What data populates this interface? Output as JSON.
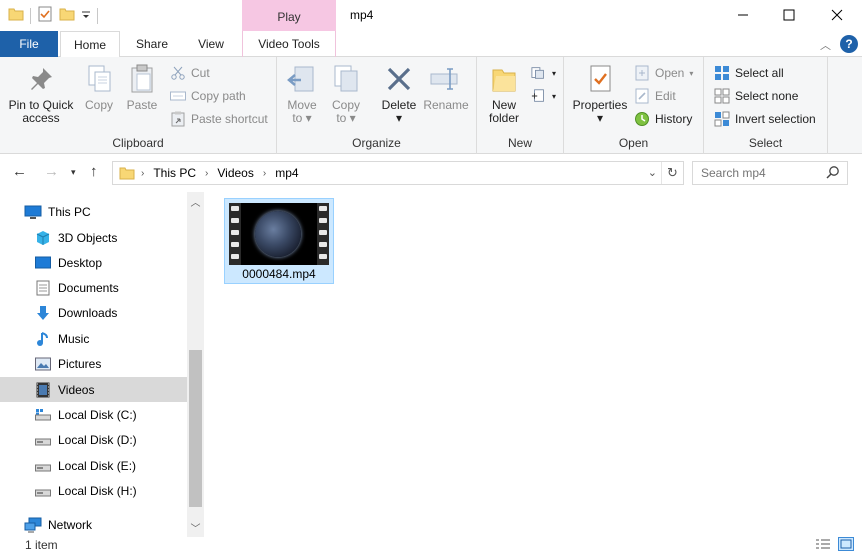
{
  "window": {
    "title": "mp4",
    "contextual_tab_header": "Play",
    "controls": {
      "minimize": "—",
      "maximize": "☐",
      "close": "✕"
    }
  },
  "tabs": {
    "file": "File",
    "home": "Home",
    "share": "Share",
    "view": "View",
    "video_tools": "Video Tools"
  },
  "ribbon": {
    "clipboard": {
      "label": "Clipboard",
      "pin_line1": "Pin to Quick",
      "pin_line2": "access",
      "copy": "Copy",
      "paste": "Paste",
      "cut": "Cut",
      "copy_path": "Copy path",
      "paste_shortcut": "Paste shortcut"
    },
    "organize": {
      "label": "Organize",
      "move_to": "Move",
      "move_to2": "to",
      "copy_to": "Copy",
      "copy_to2": "to",
      "delete": "Delete",
      "rename": "Rename"
    },
    "new": {
      "label": "New",
      "new_folder1": "New",
      "new_folder2": "folder"
    },
    "open": {
      "label": "Open",
      "properties": "Properties",
      "open": "Open",
      "edit": "Edit",
      "history": "History"
    },
    "select": {
      "label": "Select",
      "select_all": "Select all",
      "select_none": "Select none",
      "invert_selection": "Invert selection"
    }
  },
  "address": {
    "crumbs": [
      "This PC",
      "Videos",
      "mp4"
    ],
    "search_placeholder": "Search mp4"
  },
  "nav": {
    "items": [
      {
        "label": "This PC",
        "icon": "pc-icon"
      },
      {
        "label": "3D Objects",
        "icon": "3d-objects-icon"
      },
      {
        "label": "Desktop",
        "icon": "desktop-icon"
      },
      {
        "label": "Documents",
        "icon": "documents-icon"
      },
      {
        "label": "Downloads",
        "icon": "downloads-icon"
      },
      {
        "label": "Music",
        "icon": "music-icon"
      },
      {
        "label": "Pictures",
        "icon": "pictures-icon"
      },
      {
        "label": "Videos",
        "icon": "videos-icon"
      },
      {
        "label": "Local Disk (C:)",
        "icon": "drive-c-icon"
      },
      {
        "label": "Local Disk (D:)",
        "icon": "drive-icon"
      },
      {
        "label": "Local Disk (E:)",
        "icon": "drive-icon"
      },
      {
        "label": "Local Disk (H:)",
        "icon": "drive-icon"
      },
      {
        "label": "Network",
        "icon": "network-icon"
      }
    ],
    "selected": "Videos"
  },
  "files": [
    {
      "name": "0000484.mp4",
      "type": "video"
    }
  ],
  "status": {
    "item_count": "1 item"
  },
  "colors": {
    "file_tab": "#1e61a9",
    "contextual_tab": "#f6c7e3",
    "selection": "#cce8ff",
    "nav_selected": "#d9d9d9"
  }
}
